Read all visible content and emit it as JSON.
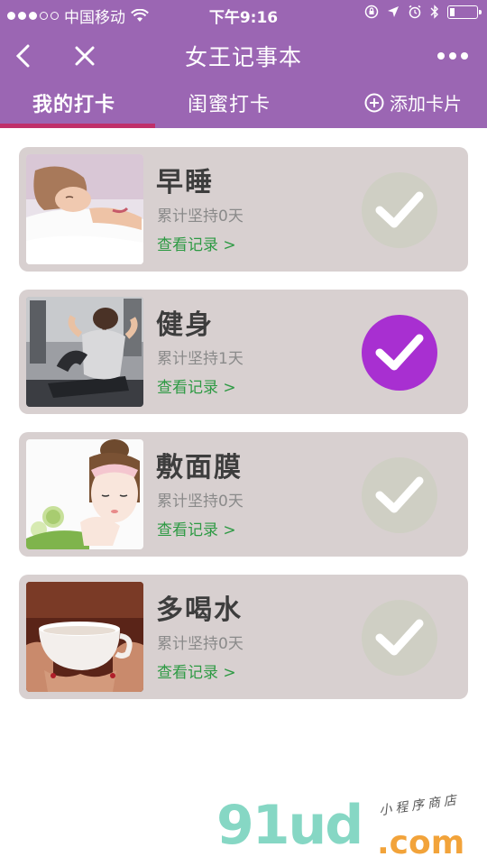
{
  "status_bar": {
    "carrier": "中国移动",
    "time": "下午9:16",
    "signal_filled": 3,
    "signal_total": 5
  },
  "nav": {
    "title": "女王记事本",
    "back_icon": "chevron-left-icon",
    "close_icon": "close-icon",
    "more_icon": "more-dots-icon"
  },
  "tabs": {
    "items": [
      {
        "label": "我的打卡",
        "active": true
      },
      {
        "label": "闺蜜打卡",
        "active": false
      }
    ],
    "add_label": "添加卡片",
    "indicator_color": "#c0306a"
  },
  "cards": [
    {
      "title": "早睡",
      "days": "累计坚持0天",
      "link": "查看记录 >",
      "checked": false,
      "image": "sleeping-woman-photo"
    },
    {
      "title": "健身",
      "days": "累计坚持1天",
      "link": "查看记录 >",
      "checked": true,
      "image": "gym-workout-photo"
    },
    {
      "title": "敷面膜",
      "days": "累计坚持0天",
      "link": "查看记录 >",
      "checked": false,
      "image": "face-mask-illustration"
    },
    {
      "title": "多喝水",
      "days": "累计坚持0天",
      "link": "查看记录 >",
      "checked": false,
      "image": "hands-holding-cup-photo"
    }
  ],
  "watermark": {
    "brand": "91ud",
    "tld": ".com",
    "tagline": "小程序商店"
  },
  "colors": {
    "header": "#9b66b3",
    "card_bg": "#d8d0d0",
    "check_on": "#a82fd1",
    "check_off": "#cfcfc4",
    "link": "#2e9a44"
  }
}
